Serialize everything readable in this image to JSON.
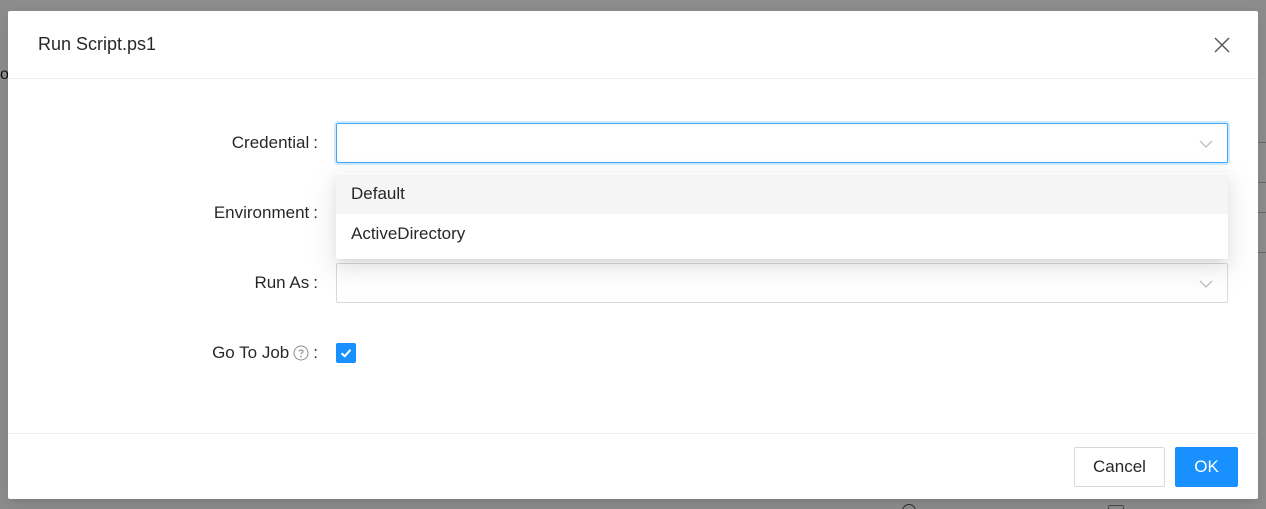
{
  "modal": {
    "title": "Run Script.ps1",
    "close_icon": "close-icon"
  },
  "form": {
    "credential": {
      "label": "Credential",
      "colon": ":",
      "value": "",
      "focused": true
    },
    "environment": {
      "label": "Environment",
      "colon": ":",
      "value": ""
    },
    "run_as": {
      "label": "Run As",
      "colon": ":",
      "value": ""
    },
    "go_to_job": {
      "label": "Go To Job",
      "colon": ":",
      "checked": true,
      "help_icon": "question-circle-icon"
    }
  },
  "dropdown": {
    "options": [
      {
        "label": "Default",
        "highlighted": true
      },
      {
        "label": "ActiveDirectory",
        "highlighted": false
      }
    ]
  },
  "footer": {
    "cancel_label": "Cancel",
    "ok_label": "OK"
  },
  "colors": {
    "primary": "#1890ff",
    "focus_border": "#40a9ff",
    "border": "#d9d9d9",
    "hover_bg": "#f5f5f5"
  }
}
